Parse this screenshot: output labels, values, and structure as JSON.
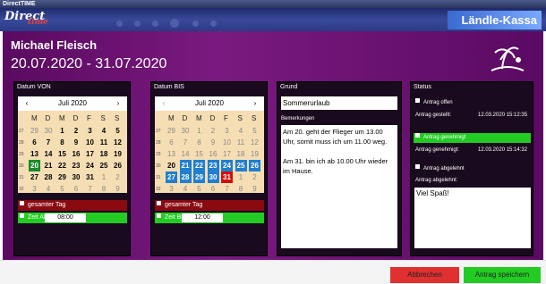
{
  "titlebar": {
    "title": "DirectTIME"
  },
  "header": {
    "logo": "Direct",
    "logo_sub": "time",
    "brand": "Ländle-Kassa"
  },
  "employee": {
    "name": "Michael Fleisch",
    "range": "20.07.2020 - 31.07.2020"
  },
  "panels": {
    "from": {
      "title": "Datum VON",
      "month": "Juli 2020"
    },
    "to": {
      "title": "Datum BIS",
      "month": "Juli 2020"
    },
    "reason": {
      "title": "Grund",
      "value": "Sommerurlaub",
      "notes_label": "Bemerkungen",
      "notes": "Am 20. geht der Flieger um 13.00 Uhr, somit muss ich um 11.00 weg.\n\nAm 31. bin ich ab 10.00 Uhr wieder im Hause."
    },
    "status": {
      "title": "Status",
      "open": "Antrag offen",
      "submitted_label": "Antrag gestellt:",
      "submitted_time": "12.03.2020 15:12:35",
      "approved": "Antrag genehmigt",
      "approved_label": "Antrag genehmigt:",
      "approved_time": "12.03.2020 15:14:32",
      "rejected": "Antrag abgelehnt",
      "rejected_label": "Antrag abgelehnt:",
      "rejected_text": "Viel Spaß!"
    }
  },
  "calendar": {
    "weekdays": [
      "M",
      "D",
      "M",
      "D",
      "F",
      "S",
      "S"
    ],
    "weeks": [
      "27",
      "28",
      "29",
      "30",
      "31",
      "32"
    ],
    "rows": [
      [
        "29",
        "30",
        "1",
        "2",
        "3",
        "4",
        "5"
      ],
      [
        "6",
        "7",
        "8",
        "9",
        "10",
        "11",
        "12"
      ],
      [
        "13",
        "14",
        "15",
        "16",
        "17",
        "18",
        "19"
      ],
      [
        "20",
        "21",
        "22",
        "23",
        "24",
        "25",
        "26"
      ],
      [
        "27",
        "28",
        "29",
        "30",
        "31",
        "1",
        "2"
      ],
      [
        "3",
        "4",
        "5",
        "6",
        "7",
        "8",
        "9"
      ]
    ]
  },
  "from_options": {
    "full_day": "gesamter Tag",
    "time_label": "Zeit AB",
    "time": "08:00"
  },
  "to_options": {
    "full_day": "gesamter Tag",
    "time_label": "Zeit BIS",
    "time": "12:00"
  },
  "buttons": {
    "cancel": "Abbrechen",
    "save": "Antrag speichern"
  },
  "colors": {
    "accent_green": "#22cc22",
    "cancel_red": "#e03030",
    "selected_blue": "#1f7fd0"
  }
}
